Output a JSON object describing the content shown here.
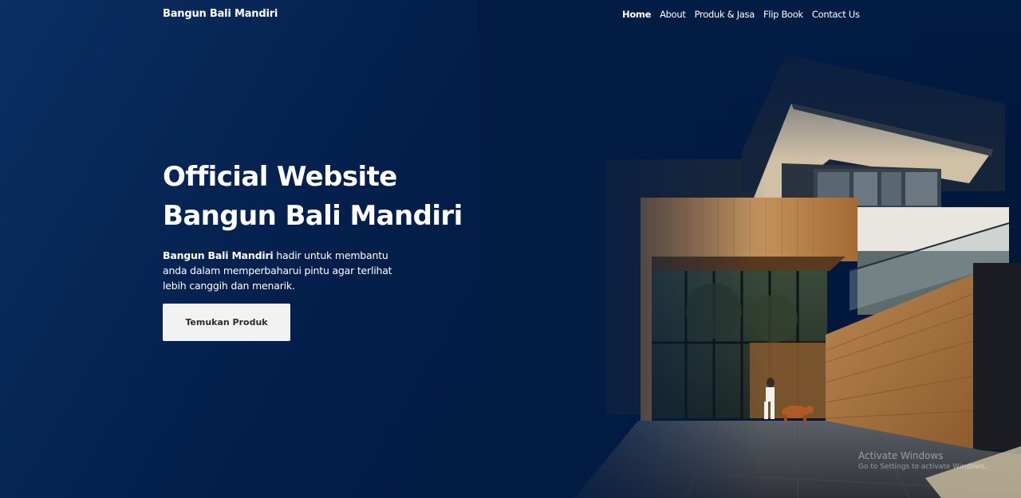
{
  "header": {
    "brand": "Bangun Bali Mandiri",
    "nav": [
      {
        "label": "Home",
        "active": true
      },
      {
        "label": "About",
        "active": false
      },
      {
        "label": "Produk & Jasa",
        "active": false
      },
      {
        "label": "Flip Book",
        "active": false
      },
      {
        "label": "Contact Us",
        "active": false
      }
    ]
  },
  "hero": {
    "title_line1": "Official Website",
    "title_line2": "Bangun Bali Mandiri",
    "desc_bold": "Bangun Bali Mandiri",
    "desc_rest": " hadir untuk membantu anda dalam memperbaharui pintu agar terlihat lebih canggih dan menarik.",
    "cta_label": "Temukan Produk"
  },
  "watermark": {
    "line1": "Activate Windows",
    "line2": "Go to Settings to activate Windows."
  },
  "colors": {
    "background": "#021b45",
    "accent_text": "#ffffff",
    "button_bg": "#f2f2f2",
    "button_text": "#2b2b2b"
  }
}
